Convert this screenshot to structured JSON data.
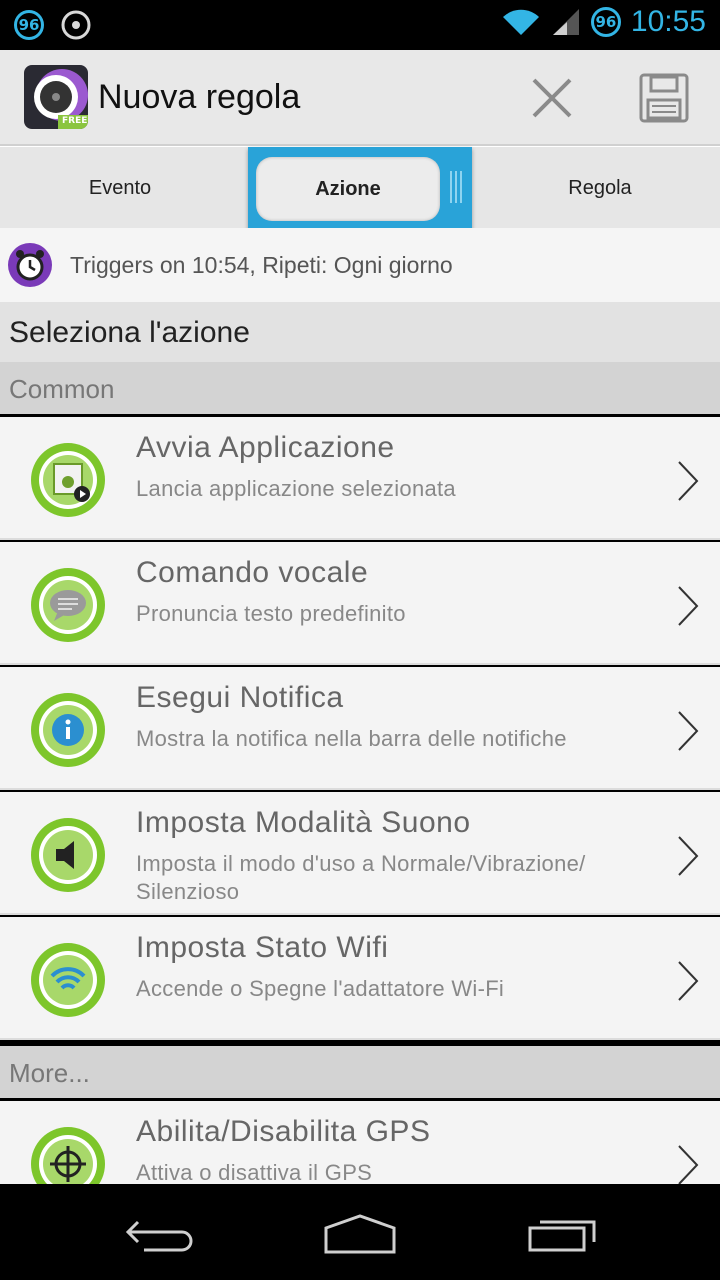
{
  "status_bar": {
    "left_badges": [
      "96"
    ],
    "right_badge": "96",
    "time": "10:55"
  },
  "action_bar": {
    "title": "Nuova regola",
    "logo_label": "FREE",
    "cancel_icon": "close-icon",
    "save_icon": "save-icon"
  },
  "tabs": [
    {
      "label": "Evento",
      "active": false
    },
    {
      "label": "Azione",
      "active": true
    },
    {
      "label": "Regola",
      "active": false
    }
  ],
  "trigger": {
    "icon": "alarm-clock-icon",
    "text": "Triggers on 10:54, Ripeti: Ogni giorno"
  },
  "section_title": "Seleziona l'azione",
  "groups": {
    "common": "Common",
    "more": "More..."
  },
  "common_items": [
    {
      "title": "Avvia Applicazione",
      "subtitle": "Lancia applicazione selezionata",
      "icon": "launch-app-icon"
    },
    {
      "title": "Comando vocale",
      "subtitle": "Pronuncia testo predefinito",
      "icon": "speech-bubble-icon"
    },
    {
      "title": "Esegui Notifica",
      "subtitle": "Mostra la notifica nella barra delle notifiche",
      "icon": "info-icon"
    },
    {
      "title": "Imposta Modalità Suono",
      "subtitle": "Imposta il modo d'uso a Normale/Vibrazione/ Silenzioso",
      "icon": "speaker-icon"
    },
    {
      "title": "Imposta Stato Wifi",
      "subtitle": "Accende o Spegne l'adattatore Wi-Fi",
      "icon": "wifi-icon"
    }
  ],
  "more_items": [
    {
      "title": "Abilita/Disabilita GPS",
      "subtitle": "Attiva o disattiva il GPS",
      "icon": "crosshair-icon"
    }
  ],
  "colors": {
    "accent": "#33b5e5",
    "tab_highlight": "#29a3d8",
    "icon_green": "#7dc62b",
    "trigger_purple": "#7a3ab8"
  }
}
